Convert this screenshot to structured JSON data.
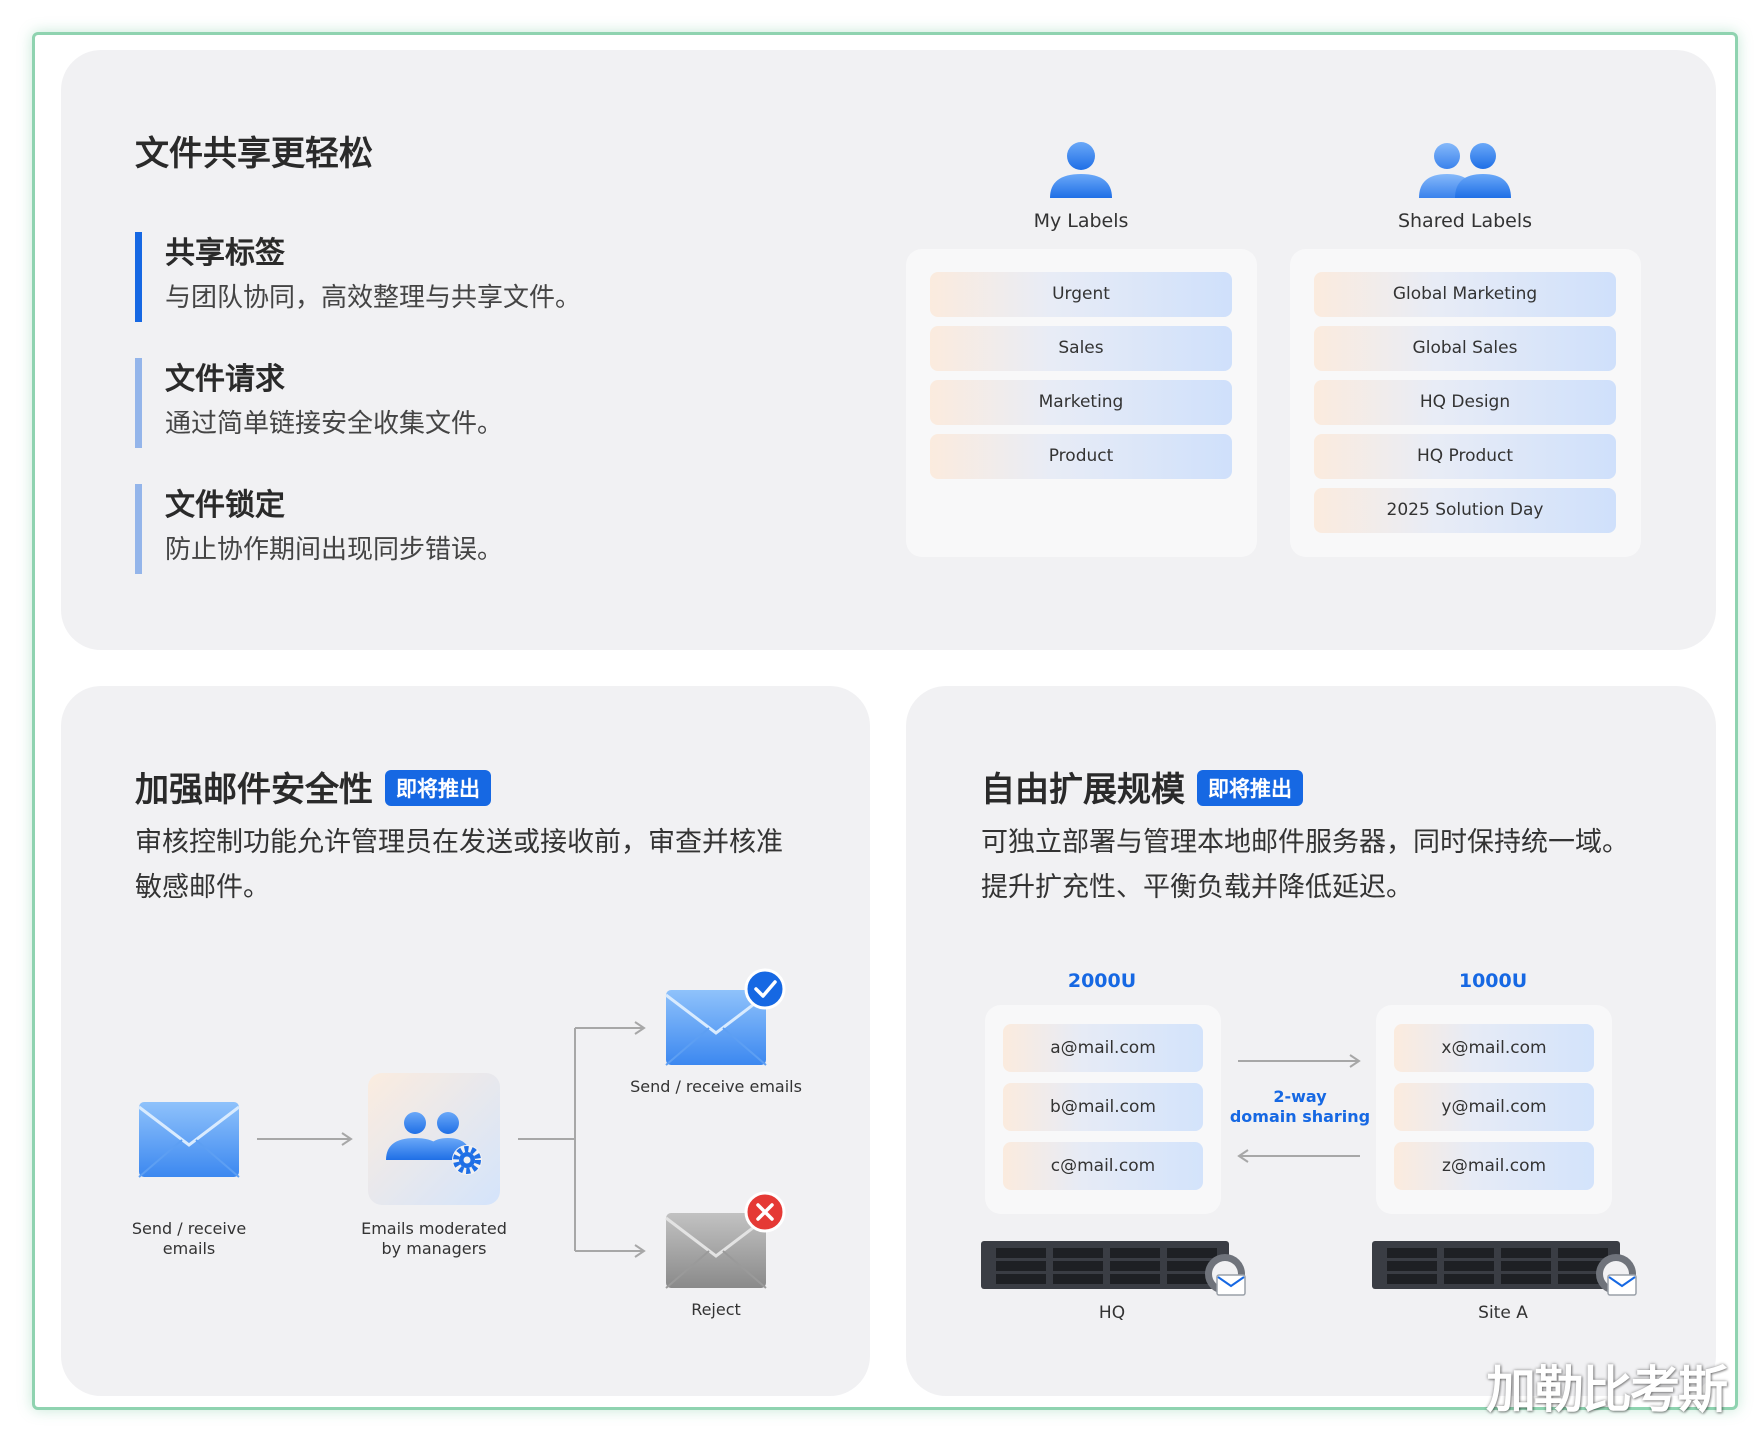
{
  "file_sharing": {
    "title": "文件共享更轻松",
    "features": [
      {
        "title": "共享标签",
        "desc": "与团队协同，高效整理与共享文件。"
      },
      {
        "title": "文件请求",
        "desc": "通过简单链接安全收集文件。"
      },
      {
        "title": "文件锁定",
        "desc": "防止协作期间出现同步错误。"
      }
    ],
    "my_labels": {
      "heading": "My Labels",
      "icon": "single-user-icon",
      "items": [
        "Urgent",
        "Sales",
        "Marketing",
        "Product"
      ]
    },
    "shared_labels": {
      "heading": "Shared Labels",
      "icon": "two-users-icon",
      "items": [
        "Global Marketing",
        "Global Sales",
        "HQ Design",
        "HQ Product",
        "2025 Solution Day"
      ]
    }
  },
  "email_security": {
    "title": "加强邮件安全性",
    "badge": "即将推出",
    "desc_line1": "审核控制功能允许管理员在发送或接收前，审查并核准",
    "desc_line2": "敏感邮件。",
    "flow": {
      "source_caption_1": "Send / receive",
      "source_caption_2": "emails",
      "moderator_caption_1": "Emails moderated",
      "moderator_caption_2": "by managers",
      "approved_caption": "Send / receive emails",
      "rejected_caption": "Reject"
    }
  },
  "scale": {
    "title": "自由扩展规模",
    "badge": "即将推出",
    "desc_line1": "可独立部署与管理本地邮件服务器，同时保持统一域。",
    "desc_line2": "提升扩充性、平衡负载并降低延迟。",
    "hq": {
      "model": "2000U",
      "emails": [
        "a@mail.com",
        "b@mail.com",
        "c@mail.com"
      ],
      "site": "HQ"
    },
    "site_a": {
      "model": "1000U",
      "emails": [
        "x@mail.com",
        "y@mail.com",
        "z@mail.com"
      ],
      "site": "Site A"
    },
    "sharing_label_1": "2-way",
    "sharing_label_2": "domain sharing"
  },
  "watermark": "加勒比考斯",
  "colors": {
    "accent": "#1668e3",
    "card": "#f1f1f3",
    "frame": "#8fd3b0",
    "approve": "#1668e3",
    "reject": "#e53935"
  }
}
